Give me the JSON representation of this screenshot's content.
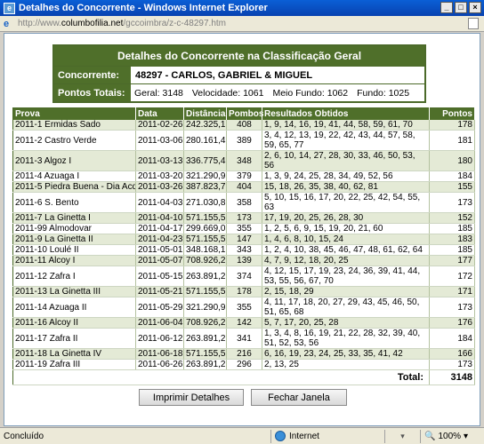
{
  "window": {
    "title": "Detalhes do Concorrente - Windows Internet Explorer",
    "url_prefix": "http://www.",
    "url_host": "columbofilia.net",
    "url_path": "/gccoimbra/z-c-48297.htm"
  },
  "info": {
    "heading": "Detalhes do Concorrente na Classificação Geral",
    "competitor_label": "Concorrente:",
    "competitor_value": "48297 - CARLOS, GABRIEL & MIGUEL",
    "points_label": "Pontos Totais:",
    "geral": "Geral: 3148",
    "velocidade": "Velocidade: 1061",
    "meio_fundo": "Meio Fundo: 1062",
    "fundo": "Fundo: 1025"
  },
  "table": {
    "headers": [
      "Prova",
      "Data",
      "Distância",
      "Pombos",
      "Resultados Obtidos",
      "Pontos"
    ],
    "rows": [
      [
        "2011-1 Ermidas Sado",
        "2011-02-26",
        "242.325,1",
        "408",
        "1, 9, 14, 16, 19, 41, 44, 58, 59, 61, 70",
        "178"
      ],
      [
        "2011-2 Castro Verde",
        "2011-03-06",
        "280.161,4",
        "389",
        "3, 4, 12, 13, 19, 22, 42, 43, 44, 57, 58, 59, 65, 77",
        "181"
      ],
      [
        "2011-3 Algoz I",
        "2011-03-13",
        "336.775,4",
        "348",
        "2, 6, 10, 14, 27, 28, 30, 33, 46, 50, 53, 56",
        "180"
      ],
      [
        "2011-4 Azuaga I",
        "2011-03-20",
        "321.290,9",
        "379",
        "1, 3, 9, 24, 25, 28, 34, 49, 52, 56",
        "184"
      ],
      [
        "2011-5 Piedra Buena - Dia Acdo",
        "2011-03-26",
        "387.823,7",
        "404",
        "15, 18, 26, 35, 38, 40, 62, 81",
        "155"
      ],
      [
        "2011-6 S. Bento",
        "2011-04-03",
        "271.030,8",
        "358",
        "5, 10, 15, 16, 17, 20, 22, 25, 42, 54, 55, 63",
        "173"
      ],
      [
        "2011-7 La Ginetta I",
        "2011-04-10",
        "571.155,5",
        "173",
        "17, 19, 20, 25, 26, 28, 30",
        "152"
      ],
      [
        "2011-99 Almodovar",
        "2011-04-17",
        "299.669,0",
        "355",
        "1, 2, 5, 6, 9, 15, 19, 20, 21, 60",
        "185"
      ],
      [
        "2011-9 La Ginetta II",
        "2011-04-23",
        "571.155,5",
        "147",
        "1, 4, 6, 8, 10, 15, 24",
        "183"
      ],
      [
        "2011-10 Loulé II",
        "2011-05-01",
        "348.168,1",
        "343",
        "1, 2, 4, 10, 38, 45, 46, 47, 48, 61, 62, 64",
        "185"
      ],
      [
        "2011-11 Alcoy I",
        "2011-05-07",
        "708.926,2",
        "139",
        "4, 7, 9, 12, 18, 20, 25",
        "177"
      ],
      [
        "2011-12 Zafra I",
        "2011-05-15",
        "263.891,2",
        "374",
        "4, 12, 15, 17, 19, 23, 24, 36, 39, 41, 44, 53, 55, 56, 67, 70",
        "172"
      ],
      [
        "2011-13 La Ginetta III",
        "2011-05-21",
        "571.155,5",
        "178",
        "2, 15, 18, 29",
        "171"
      ],
      [
        "2011-14 Azuaga II",
        "2011-05-29",
        "321.290,9",
        "355",
        "4, 11, 17, 18, 20, 27, 29, 43, 45, 46, 50, 51, 65, 68",
        "173"
      ],
      [
        "2011-16 Alcoy II",
        "2011-06-04",
        "708.926,2",
        "142",
        "5, 7, 17, 20, 25, 28",
        "176"
      ],
      [
        "2011-17 Zafra II",
        "2011-06-12",
        "263.891,2",
        "341",
        "1, 3, 4, 8, 16, 19, 21, 22, 28, 32, 39, 40, 51, 52, 53, 56",
        "184"
      ],
      [
        "2011-18 La Ginetta IV",
        "2011-06-18",
        "571.155,5",
        "216",
        "6, 16, 19, 23, 24, 25, 33, 35, 41, 42",
        "166"
      ],
      [
        "2011-19 Zafra III",
        "2011-06-26",
        "263.891,2",
        "296",
        "2, 13, 25",
        "173"
      ]
    ],
    "total_label": "Total:",
    "total_value": "3148"
  },
  "buttons": {
    "print": "Imprimir Detalhes",
    "close": "Fechar Janela"
  },
  "statusbar": {
    "status": "Concluído",
    "zone": "Internet",
    "zoom": "100%"
  },
  "colors": {
    "header_green": "#4f6f2a",
    "row_alt": "#e4ead6"
  }
}
